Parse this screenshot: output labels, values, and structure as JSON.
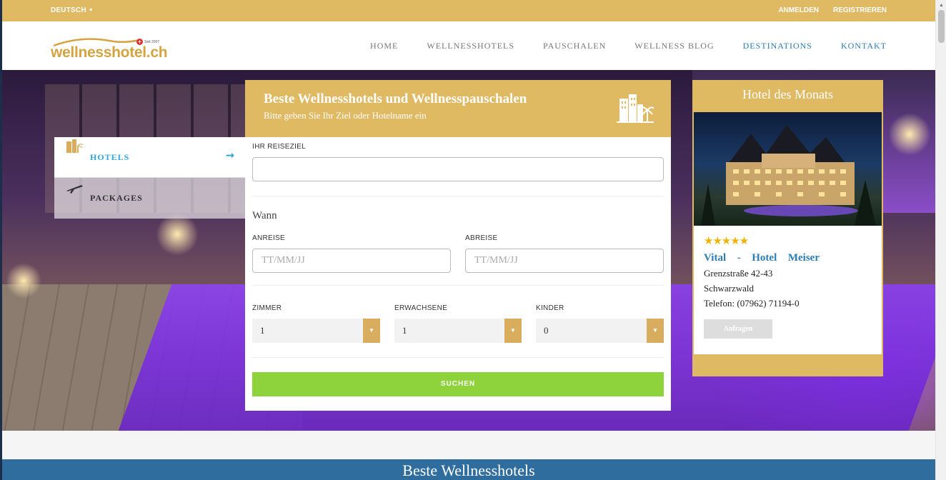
{
  "topbar": {
    "language": "DEUTSCH",
    "login": "ANMELDEN",
    "register": "REGISTRIEREN"
  },
  "logo": {
    "text": "wellnesshotel.ch",
    "since": "Seit 2007"
  },
  "nav": {
    "items": [
      "HOME",
      "WELLNESSHOTELS",
      "PAUSCHALEN",
      "WELLNESS BLOG",
      "DESTINATIONS",
      "KONTAKT"
    ]
  },
  "tabs": {
    "hotels": "HOTELS",
    "packages": "PACKAGES"
  },
  "search": {
    "title": "Beste Wellnesshotels und Wellnesspauschalen",
    "subtitle": "Bitte geben Sie Ihr Ziel oder Hotelname ein",
    "destination_label": "IHR REISEZIEL",
    "destination_value": "",
    "when_label": "Wann",
    "arrival_label": "ANREISE",
    "arrival_placeholder": "TT/MM/JJ",
    "departure_label": "ABREISE",
    "departure_placeholder": "TT/MM/JJ",
    "rooms_label": "ZIMMER",
    "rooms_value": "1",
    "adults_label": "ERWACHSENE",
    "adults_value": "1",
    "children_label": "KINDER",
    "children_value": "0",
    "submit": "SUCHEN"
  },
  "hotel_of_month": {
    "title": "Hotel des Monats",
    "stars": "★★★★★",
    "rating": 4.5,
    "name_parts": [
      "Vital",
      "-",
      "Hotel",
      "Meiser"
    ],
    "street": "Grenzstraße 42-43",
    "region": "Schwarzwald",
    "phone": "Telefon: (07962) 71194-0",
    "button": "Anfragen"
  },
  "bottom": {
    "heading": "Beste Wellnesshotels"
  },
  "colors": {
    "gold": "#e0b963",
    "blue_link": "#2a7db6",
    "green_button": "#8fd33c",
    "strip": "#2e6d9e"
  }
}
